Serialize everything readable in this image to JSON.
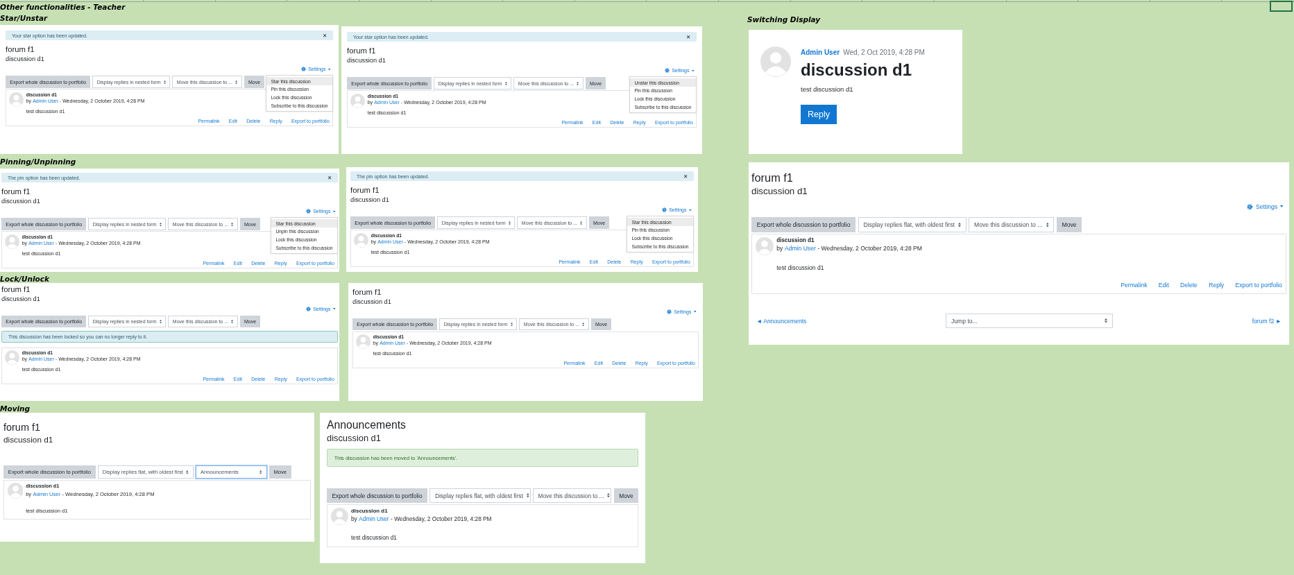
{
  "sheet_title": "Other functionalities - Teacher",
  "sections": [
    {
      "heading": "Star/Unstar",
      "panels": [
        {
          "kind": "classic",
          "alert_top": {
            "text": "Your star option has been updated.",
            "kind": "info",
            "dismissible": true
          },
          "forum_title": "forum f1",
          "discussion_title": "discussion d1",
          "settings": {
            "label": "Settings",
            "menu": [
              {
                "label": "Star this discussion",
                "highlighted": true
              },
              {
                "label": "Pin this discussion",
                "highlighted": false
              },
              {
                "label": "Lock this discussion",
                "highlighted": false
              },
              {
                "label": "Subscribe to this discussion",
                "highlighted": false
              }
            ]
          },
          "toolbar": {
            "export_label": "Export whole discussion to portfolio",
            "display_select": "Display replies in nested form",
            "move_select": "Move this discussion to ...",
            "move_select_focused": false,
            "move_label": "Move"
          },
          "post": {
            "subject": "discussion d1",
            "by": "by",
            "author": "Admin User",
            "date": "- Wednesday, 2 October 2019, 4:28 PM",
            "body": "test discussion d1",
            "actions": [
              "Permalink",
              "Edit",
              "Delete",
              "Reply",
              "Export to portfolio"
            ]
          }
        },
        {
          "kind": "classic",
          "alert_top": {
            "text": "Your star option has been updated.",
            "kind": "info",
            "dismissible": true
          },
          "forum_title": "forum f1",
          "discussion_title": "discussion d1",
          "settings": {
            "label": "Settings",
            "menu": [
              {
                "label": "Unstar this discussion",
                "highlighted": true
              },
              {
                "label": "Pin this discussion",
                "highlighted": false
              },
              {
                "label": "Lock this discussion",
                "highlighted": false
              },
              {
                "label": "Subscribe to this discussion",
                "highlighted": false
              }
            ]
          },
          "toolbar": {
            "export_label": "Export whole discussion to portfolio",
            "display_select": "Display replies in nested form",
            "move_select": "Move this discussion to ...",
            "move_select_focused": false,
            "move_label": "Move"
          },
          "post": {
            "subject": "discussion d1",
            "by": "by",
            "author": "Admin User",
            "date": "- Wednesday, 2 October 2019, 4:28 PM",
            "body": "test discussion d1",
            "actions": [
              "Permalink",
              "Edit",
              "Delete",
              "Reply",
              "Export to portfolio"
            ]
          }
        }
      ]
    },
    {
      "heading": "Pinning/Unpinning",
      "panels": [
        {
          "kind": "classic",
          "alert_top": {
            "text": "The pin option has been updated.",
            "kind": "info",
            "dismissible": true
          },
          "forum_title": "forum f1",
          "discussion_title": "discussion d1",
          "settings": {
            "label": "Settings",
            "menu": [
              {
                "label": "Star this discussion",
                "highlighted": true
              },
              {
                "label": "Unpin this discussion",
                "highlighted": false
              },
              {
                "label": "Lock this discussion",
                "highlighted": false
              },
              {
                "label": "Subscribe to this discussion",
                "highlighted": false
              }
            ]
          },
          "toolbar": {
            "export_label": "Export whole discussion to portfolio",
            "display_select": "Display replies in nested form",
            "move_select": "Move this discussion to ...",
            "move_select_focused": false,
            "move_label": "Move"
          },
          "post": {
            "subject": "discussion d1",
            "by": "by",
            "author": "Admin User",
            "date": "- Wednesday, 2 October 2019, 4:28 PM",
            "body": "test discussion d1",
            "actions": [
              "Permalink",
              "Edit",
              "Delete",
              "Reply",
              "Export to portfolio"
            ]
          }
        },
        {
          "kind": "classic",
          "alert_top": {
            "text": "The pin option has been updated.",
            "kind": "info",
            "dismissible": true
          },
          "forum_title": "forum f1",
          "discussion_title": "discussion d1",
          "settings": {
            "label": "Settings",
            "menu": [
              {
                "label": "Star this discussion",
                "highlighted": true
              },
              {
                "label": "Pin this discussion",
                "highlighted": false
              },
              {
                "label": "Lock this discussion",
                "highlighted": false
              },
              {
                "label": "Subscribe to this discussion",
                "highlighted": false
              }
            ]
          },
          "toolbar": {
            "export_label": "Export whole discussion to portfolio",
            "display_select": "Display replies in nested form",
            "move_select": "Move this discussion to ...",
            "move_select_focused": false,
            "move_label": "Move"
          },
          "post": {
            "subject": "discussion d1",
            "by": "by",
            "author": "Admin User",
            "date": "- Wednesday, 2 October 2019, 4:28 PM",
            "body": "test discussion d1",
            "actions": [
              "Permalink",
              "Edit",
              "Delete",
              "Reply",
              "Export to portfolio"
            ]
          }
        }
      ]
    },
    {
      "heading": "Lock/Unlock",
      "panels": [
        {
          "kind": "classic",
          "forum_title": "forum f1",
          "discussion_title": "discussion d1",
          "settings": {
            "label": "Settings"
          },
          "toolbar": {
            "export_label": "Export whole discussion to portfolio",
            "display_select": "Display replies in nested form",
            "move_select": "Move this discussion to ...",
            "move_select_focused": false,
            "move_label": "Move"
          },
          "alert_after_toolbar": {
            "text": "This discussion has been locked so you can no longer reply to it.",
            "kind": "notice",
            "dismissible": false
          },
          "post": {
            "subject": "discussion d1",
            "by": "by",
            "author": "Admin User",
            "date": "- Wednesday, 2 October 2019, 4:28 PM",
            "body": "test discussion d1",
            "actions": [
              "Permalink",
              "Edit",
              "Delete",
              "Reply",
              "Export to portfolio"
            ]
          }
        },
        {
          "kind": "classic",
          "forum_title": "forum f1",
          "discussion_title": "discussion d1",
          "settings": {
            "label": "Settings"
          },
          "toolbar": {
            "export_label": "Export whole discussion to portfolio",
            "display_select": "Display replies in nested form",
            "move_select": "Move this discussion to ...",
            "move_select_focused": false,
            "move_label": "Move"
          },
          "post": {
            "subject": "discussion d1",
            "by": "by",
            "author": "Admin User",
            "date": "- Wednesday, 2 October 2019, 4:28 PM",
            "body": "test discussion d1",
            "actions": [
              "Permalink",
              "Edit",
              "Delete",
              "Reply",
              "Export to portfolio"
            ]
          }
        }
      ]
    },
    {
      "heading": "Moving",
      "panels": [
        {
          "kind": "classic",
          "forum_title": "forum f1",
          "discussion_title": "discussion d1",
          "toolbar": {
            "export_label": "Export whole discussion to portfolio",
            "display_select": "Display replies flat, with oldest first",
            "move_select": "Announcements",
            "move_select_focused": true,
            "move_label": "Move"
          },
          "post": {
            "subject": "discussion d1",
            "by": "by",
            "author": "Admin User",
            "date": "- Wednesday, 2 October 2019, 4:28 PM",
            "body": "test discussion d1"
          }
        },
        {
          "kind": "classic",
          "forum_title": "Announcements",
          "discussion_title": "discussion d1",
          "alert_after_title": {
            "text": "This discussion has been moved to 'Announcements'.",
            "kind": "success",
            "dismissible": false
          },
          "toolbar": {
            "export_label": "Export whole discussion to portfolio",
            "display_select": "Display replies flat, with oldest first",
            "move_select": "Move this discussion to ...",
            "move_select_focused": false,
            "move_label": "Move"
          },
          "post": {
            "subject": "discussion d1",
            "by": "by",
            "author": "Admin User",
            "date": "- Wednesday, 2 October 2019, 4:28 PM",
            "body": "test discussion d1"
          }
        }
      ]
    },
    {
      "heading": "Switching Display",
      "panels": [
        {
          "kind": "card",
          "author": "Admin User",
          "date": "Wed, 2 Oct 2019, 4:28 PM",
          "title": "discussion d1",
          "body": "test discussion d1",
          "reply_label": "Reply"
        },
        {
          "kind": "classic",
          "forum_title": "forum f1",
          "discussion_title": "discussion d1",
          "settings": {
            "label": "Settings"
          },
          "toolbar": {
            "export_label": "Export whole discussion to portfolio",
            "display_select": "Display replies flat, with oldest first",
            "move_select": "Move this discussion to ...",
            "move_select_focused": false,
            "move_label": "Move"
          },
          "post": {
            "subject": "discussion d1",
            "by": "by",
            "author": "Admin User",
            "date": "- Wednesday, 2 October 2019, 4:28 PM",
            "body": "test discussion d1",
            "actions": [
              "Permalink",
              "Edit",
              "Delete",
              "Reply",
              "Export to portfolio"
            ]
          },
          "navigation": {
            "previous": "◄ Announcements",
            "jump": "Jump to...",
            "next": "forum f2 ►"
          }
        }
      ]
    }
  ]
}
